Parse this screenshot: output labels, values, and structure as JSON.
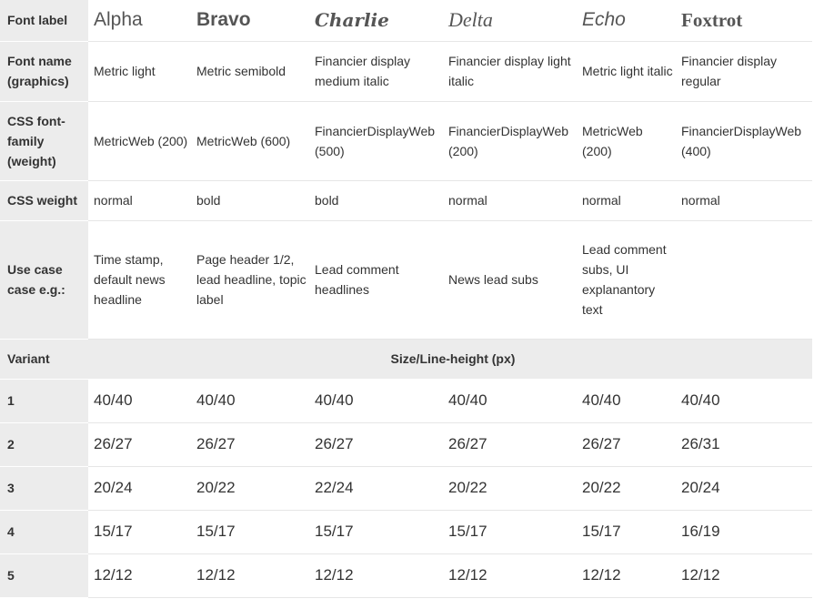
{
  "header": {
    "label": "Font label",
    "cells": [
      "Alpha",
      "Bravo",
      "Charlie",
      "Delta",
      "Echo",
      "Foxtrot"
    ]
  },
  "rows": [
    {
      "label": "Font name (graphics)",
      "cells": [
        "Metric light",
        "Metric semibold",
        "Financier display medium italic",
        "Financier display light italic",
        "Metric light italic",
        "Financier display regular"
      ]
    },
    {
      "label": "CSS font-family (weight)",
      "cells": [
        "MetricWeb (200)",
        "MetricWeb (600)",
        "FinancierDisplayWeb (500)",
        "FinancierDisplayWeb (200)",
        "MetricWeb (200)",
        "FinancierDisplayWeb (400)"
      ]
    },
    {
      "label": "CSS weight",
      "cells": [
        "normal",
        "bold",
        "bold",
        "normal",
        "normal",
        "normal"
      ]
    },
    {
      "label": "Use case case e.g.:",
      "cells": [
        "Time stamp, default news headline",
        "Page header 1/2, lead headline, topic label",
        "Lead comment headlines",
        "News lead subs",
        "Lead comment subs, UI explanantory text",
        ""
      ]
    }
  ],
  "variant": {
    "label": "Variant",
    "span_label": "Size/Line-height (px)"
  },
  "sizes": [
    {
      "label": "1",
      "cells": [
        "40/40",
        "40/40",
        "40/40",
        "40/40",
        "40/40",
        "40/40"
      ]
    },
    {
      "label": "2",
      "cells": [
        "26/27",
        "26/27",
        "26/27",
        "26/27",
        "26/27",
        "26/31"
      ]
    },
    {
      "label": "3",
      "cells": [
        "20/24",
        "20/22",
        "22/24",
        "20/22",
        "20/22",
        "20/24"
      ]
    },
    {
      "label": "4",
      "cells": [
        "15/17",
        "15/17",
        "15/17",
        "15/17",
        "15/17",
        "16/19"
      ]
    },
    {
      "label": "5",
      "cells": [
        "12/12",
        "12/12",
        "12/12",
        "12/12",
        "12/12",
        "12/12"
      ]
    }
  ]
}
